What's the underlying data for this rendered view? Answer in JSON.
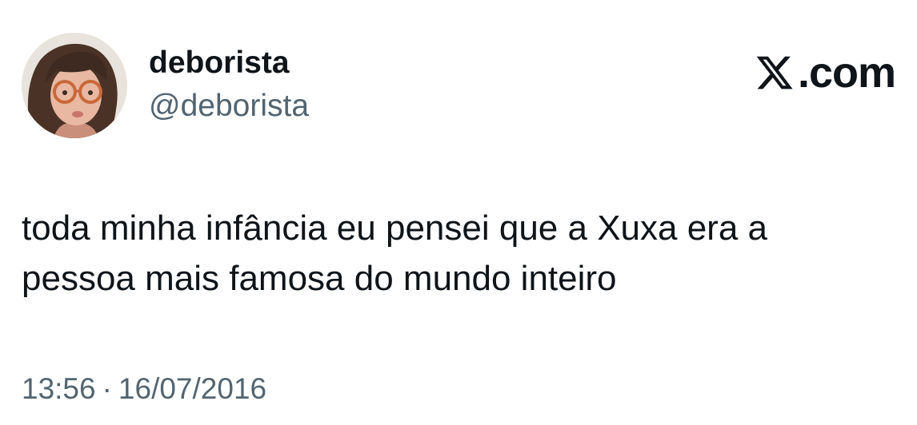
{
  "author": {
    "display_name": "deborista",
    "handle": "@deborista",
    "avatar_icon": "profile-photo"
  },
  "brand": {
    "logo_icon": "x-logo-icon",
    "text": ".com"
  },
  "tweet": {
    "text": "toda minha infância eu pensei que a Xuxa era a\npessoa mais famosa do mundo inteiro",
    "time": "13:56",
    "separator": "·",
    "date": "16/07/2016"
  },
  "colors": {
    "text_primary": "#0f1419",
    "text_secondary": "#536471",
    "background": "#ffffff"
  }
}
